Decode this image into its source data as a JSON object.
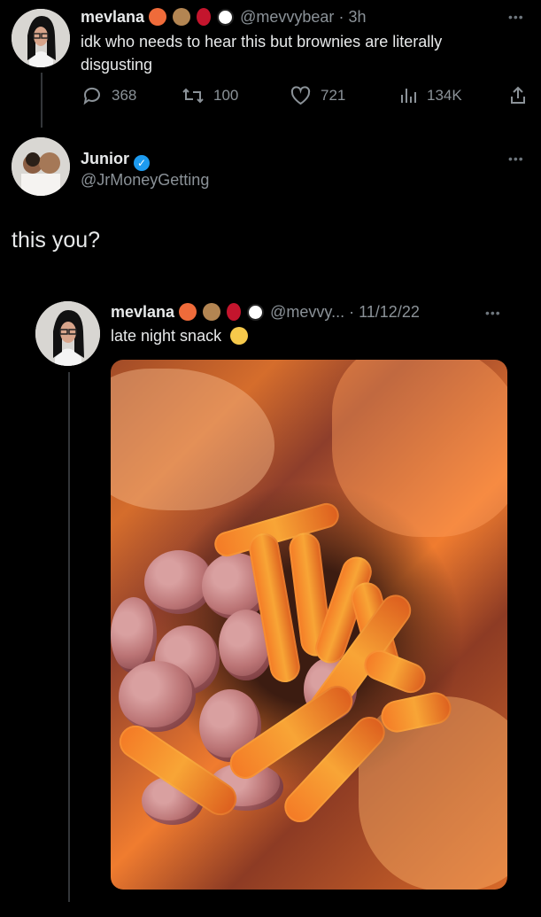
{
  "top_tweet": {
    "display_name": "mevlana",
    "handle": "@mevvybear",
    "time": "3h",
    "text": "idk who needs to hear this but brownies are literally disgusting",
    "metrics": {
      "replies": "368",
      "retweets": "100",
      "likes": "721",
      "views": "134K"
    }
  },
  "reply": {
    "display_name": "Junior",
    "handle": "@JrMoneyGetting",
    "text": "this you?"
  },
  "quoted_tweet": {
    "display_name": "mevlana",
    "handle": "@mevvy...",
    "date": "11/12/22",
    "text": "late night snack"
  },
  "icons": {
    "reply": "reply-icon",
    "retweet": "retweet-icon",
    "like": "heart-icon",
    "views": "views-icon",
    "share": "share-icon",
    "verified": "verified-badge-icon"
  },
  "colors": {
    "background": "#000000",
    "text": "#e7e9ea",
    "muted": "#8b9298",
    "verified": "#1d9bf0"
  }
}
